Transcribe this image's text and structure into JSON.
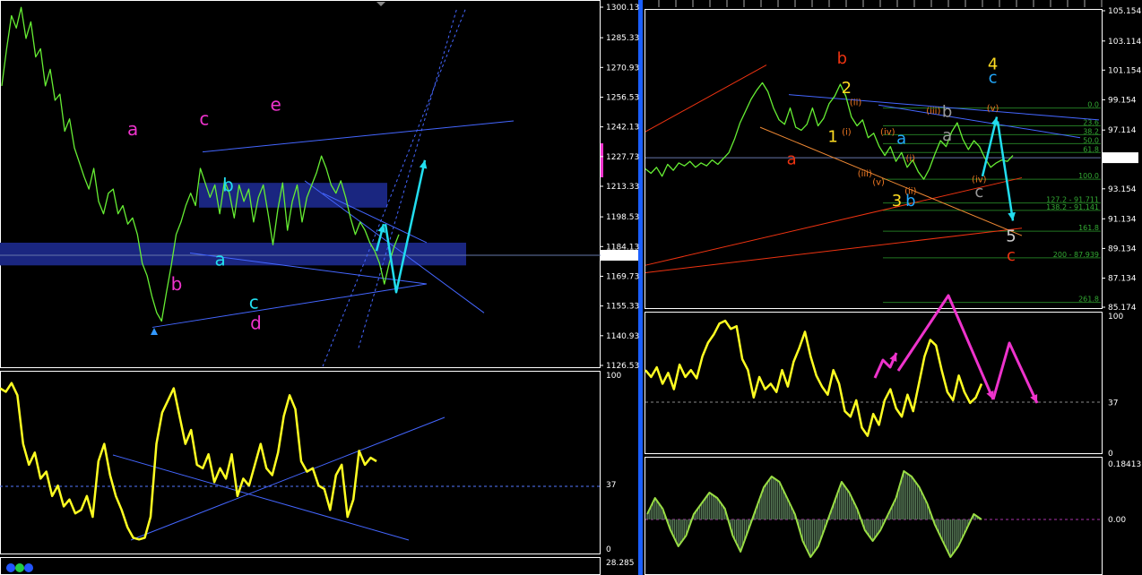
{
  "colors": {
    "background": "#000000",
    "price": "#66ee33",
    "oscillator": "#ffff22",
    "channel": "#4466ff",
    "red_channel": "#ee3311",
    "box": "#1a2680",
    "cyan": "#22ddee",
    "magenta": "#ee33cc",
    "divider": "#1a5fff",
    "grid_text": "#ffffff"
  },
  "left_panel": {
    "price_chart": {
      "type": "line",
      "yaxis_ticks": [
        "1300.13",
        "1285.33",
        "1270.93",
        "1256.53",
        "1242.13",
        "1227.73",
        "1213.33",
        "1198.53",
        "1184.13",
        "1169.73",
        "1155.33",
        "1140.93",
        "1126.53"
      ],
      "ylim": [
        1126.53,
        1300.13
      ],
      "current_price": "1179.92",
      "values": [
        1262,
        1280,
        1296,
        1290,
        1300,
        1285,
        1293,
        1276,
        1280,
        1262,
        1270,
        1255,
        1258,
        1240,
        1246,
        1232,
        1225,
        1218,
        1212,
        1222,
        1206,
        1200,
        1210,
        1212,
        1200,
        1204,
        1195,
        1198,
        1190,
        1176,
        1170,
        1160,
        1152,
        1148,
        1162,
        1175,
        1190,
        1196,
        1204,
        1210,
        1204,
        1222,
        1215,
        1208,
        1214,
        1200,
        1216,
        1210,
        1198,
        1214,
        1206,
        1212,
        1196,
        1208,
        1214,
        1200,
        1185,
        1202,
        1215,
        1192,
        1206,
        1214,
        1196,
        1208,
        1214,
        1220,
        1228,
        1222,
        1214,
        1210,
        1216,
        1208,
        1198,
        1190,
        1196,
        1192,
        1186,
        1182,
        1176,
        1166,
        1176,
        1184,
        1190
      ],
      "wave_labels": [
        {
          "text": "a",
          "color": "#ee33cc",
          "data_x": 0.33,
          "data_y": 1238
        },
        {
          "text": "b",
          "color": "#ee33cc",
          "data_x": 0.44,
          "data_y": 1163
        },
        {
          "text": "c",
          "color": "#ee33cc",
          "data_x": 0.51,
          "data_y": 1243
        },
        {
          "text": "d",
          "color": "#ee33cc",
          "data_x": 0.64,
          "data_y": 1144
        },
        {
          "text": "e",
          "color": "#ee33cc",
          "data_x": 0.69,
          "data_y": 1250
        },
        {
          "text": "a",
          "color": "#22ddee",
          "data_x": 0.55,
          "data_y": 1175
        },
        {
          "text": "b",
          "color": "#22ddee",
          "data_x": 0.57,
          "data_y": 1211
        },
        {
          "text": "c",
          "color": "#22ddee",
          "data_x": 0.635,
          "data_y": 1154
        }
      ]
    },
    "oscillator": {
      "type": "line",
      "yaxis_ticks": [
        "100",
        "37",
        "0"
      ],
      "ylim": [
        0,
        100
      ],
      "values": [
        92,
        90,
        95,
        88,
        60,
        48,
        55,
        40,
        44,
        30,
        36,
        24,
        28,
        20,
        22,
        30,
        18,
        50,
        60,
        42,
        30,
        22,
        12,
        6,
        5,
        6,
        18,
        60,
        78,
        85,
        92,
        76,
        60,
        68,
        48,
        46,
        54,
        38,
        46,
        40,
        54,
        30,
        40,
        36,
        48,
        60,
        46,
        42,
        55,
        76,
        88,
        80,
        50,
        44,
        46,
        36,
        34,
        22,
        42,
        48,
        18,
        28,
        56,
        48,
        52,
        50
      ]
    },
    "bottom_axis_value": "28.285"
  },
  "right_panel": {
    "price_chart": {
      "type": "line",
      "yaxis_ticks": [
        "105.154",
        "103.114",
        "101.154",
        "99.154",
        "97.114",
        "95.250",
        "93.154",
        "91.134",
        "89.134",
        "87.134",
        "85.174"
      ],
      "ylim": [
        85.174,
        105.154
      ],
      "current_price": "95.250",
      "values": [
        94.5,
        94.2,
        94.6,
        94.0,
        94.8,
        94.4,
        94.9,
        94.7,
        95.0,
        94.6,
        94.9,
        94.7,
        95.1,
        94.8,
        95.2,
        95.6,
        96.5,
        97.6,
        98.4,
        99.2,
        99.8,
        100.3,
        99.7,
        98.6,
        97.8,
        97.5,
        98.6,
        97.3,
        97.1,
        97.5,
        98.6,
        97.4,
        97.9,
        98.9,
        99.4,
        100.2,
        99.4,
        98.0,
        97.4,
        97.8,
        96.6,
        96.9,
        96.0,
        95.4,
        96.0,
        95.0,
        95.6,
        94.6,
        95.1,
        94.3,
        93.8,
        94.5,
        95.5,
        96.4,
        96.0,
        97.0,
        97.6,
        96.5,
        95.8,
        96.4,
        96.0,
        95.2,
        94.6,
        94.9,
        95.1,
        95.0,
        95.4
      ],
      "fib_levels": [
        {
          "label": "0.0",
          "value": 98.6
        },
        {
          "label": "23.6",
          "value": 97.4
        },
        {
          "label": "38.2",
          "value": 96.8
        },
        {
          "label": "50.0",
          "value": 96.2
        },
        {
          "label": "61.8",
          "value": 95.6
        },
        {
          "label": "100.0",
          "value": 93.8
        },
        {
          "label": "127.2 - 91.711",
          "value": 92.2
        },
        {
          "label": "138.2 - 91.141",
          "value": 91.7
        },
        {
          "label": "161.8",
          "value": 90.3
        },
        {
          "label": "200 - 87.939",
          "value": 88.5
        },
        {
          "label": "261.8",
          "value": 85.5
        }
      ],
      "wave_labels": [
        {
          "text": "b",
          "color": "#ee3311",
          "data_x": 0.43,
          "data_y": 101.6
        },
        {
          "text": "a",
          "color": "#ee3311",
          "data_x": 0.32,
          "data_y": 94.8
        },
        {
          "text": "c",
          "color": "#ee3311",
          "data_x": 0.8,
          "data_y": 88.3
        },
        {
          "text": "2",
          "color": "#ffdd22",
          "data_x": 0.44,
          "data_y": 99.6
        },
        {
          "text": "1",
          "color": "#ffdd22",
          "data_x": 0.41,
          "data_y": 96.3
        },
        {
          "text": "3",
          "color": "#ffdd22",
          "data_x": 0.55,
          "data_y": 92.0
        },
        {
          "text": "4",
          "color": "#ffdd22",
          "data_x": 0.76,
          "data_y": 101.2
        },
        {
          "text": "5",
          "color": "#cccccc",
          "data_x": 0.8,
          "data_y": 89.6
        },
        {
          "text": "a",
          "color": "#22aaff",
          "data_x": 0.56,
          "data_y": 96.2
        },
        {
          "text": "b",
          "color": "#22aaff",
          "data_x": 0.58,
          "data_y": 92.0
        },
        {
          "text": "c",
          "color": "#22aaff",
          "data_x": 0.76,
          "data_y": 100.3
        },
        {
          "text": "(ii)",
          "color": "#ee7722",
          "data_x": 0.46,
          "data_y": 98.8
        },
        {
          "text": "(i)",
          "color": "#ee7722",
          "data_x": 0.44,
          "data_y": 96.8
        },
        {
          "text": "(iii)",
          "color": "#ee7722",
          "data_x": 0.48,
          "data_y": 94.0
        },
        {
          "text": "(iv)",
          "color": "#ee7722",
          "data_x": 0.53,
          "data_y": 96.8
        },
        {
          "text": "(v)",
          "color": "#ee7722",
          "data_x": 0.51,
          "data_y": 93.4
        },
        {
          "text": "(i)",
          "color": "#ee7722",
          "data_x": 0.58,
          "data_y": 95.0
        },
        {
          "text": "(ii)",
          "color": "#ee7722",
          "data_x": 0.58,
          "data_y": 92.8
        },
        {
          "text": "(iii)",
          "color": "#ee7722",
          "data_x": 0.63,
          "data_y": 98.2
        },
        {
          "text": "(iv)",
          "color": "#ee7722",
          "data_x": 0.73,
          "data_y": 93.6
        },
        {
          "text": "(v)",
          "color": "#ee7722",
          "data_x": 0.76,
          "data_y": 98.4
        },
        {
          "text": "b",
          "color": "#999999",
          "data_x": 0.66,
          "data_y": 98.0
        },
        {
          "text": "a",
          "color": "#999999",
          "data_x": 0.66,
          "data_y": 96.4
        },
        {
          "text": "c",
          "color": "#999999",
          "data_x": 0.73,
          "data_y": 92.6
        }
      ]
    },
    "oscillator": {
      "type": "line",
      "yaxis_ticks": [
        "100",
        "37",
        "0"
      ],
      "ylim": [
        0,
        100
      ],
      "values": [
        60,
        55,
        62,
        50,
        58,
        46,
        64,
        55,
        60,
        54,
        70,
        80,
        86,
        94,
        96,
        90,
        92,
        68,
        60,
        40,
        55,
        46,
        50,
        44,
        60,
        48,
        66,
        76,
        88,
        70,
        56,
        48,
        42,
        60,
        50,
        30,
        26,
        38,
        18,
        12,
        28,
        20,
        38,
        46,
        32,
        26,
        42,
        30,
        50,
        70,
        82,
        78,
        60,
        44,
        38,
        56,
        44,
        36,
        40,
        50
      ]
    },
    "histogram": {
      "type": "area",
      "yaxis_ticks": [
        "0.18413",
        "0.00"
      ],
      "values": [
        0.1,
        0.4,
        0.2,
        -0.2,
        -0.5,
        -0.3,
        0.1,
        0.3,
        0.5,
        0.4,
        0.2,
        -0.3,
        -0.6,
        -0.2,
        0.2,
        0.6,
        0.8,
        0.7,
        0.4,
        0.1,
        -0.4,
        -0.7,
        -0.5,
        -0.1,
        0.3,
        0.7,
        0.5,
        0.2,
        -0.2,
        -0.4,
        -0.2,
        0.1,
        0.4,
        0.9,
        0.8,
        0.6,
        0.3,
        -0.1,
        -0.4,
        -0.7,
        -0.5,
        -0.2,
        0.1,
        0.0
      ]
    }
  }
}
